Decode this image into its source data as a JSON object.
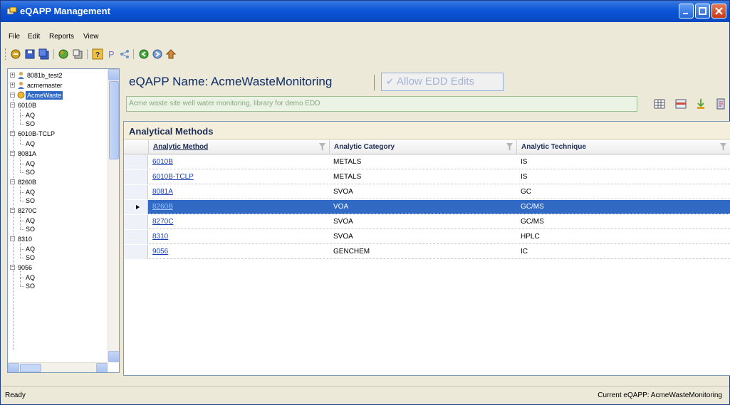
{
  "window": {
    "title": "eQAPP Management"
  },
  "menu": {
    "items": [
      {
        "label": "File",
        "accel": "F"
      },
      {
        "label": "Edit",
        "accel": "E"
      },
      {
        "label": "Reports",
        "accel": "R"
      },
      {
        "label": "View",
        "accel": "V"
      }
    ]
  },
  "tree": {
    "nodes": [
      {
        "label": "8081b_test2",
        "level": 0
      },
      {
        "label": "acmemaster",
        "level": 0
      },
      {
        "label": "AcmeWaste",
        "level": 0,
        "selected": true
      },
      {
        "label": "6010B",
        "level": 1
      },
      {
        "label": "AQ",
        "level": 2
      },
      {
        "label": "SO",
        "level": 2
      },
      {
        "label": "6010B-TCLP",
        "level": 1
      },
      {
        "label": "AQ",
        "level": 2
      },
      {
        "label": "8081A",
        "level": 1
      },
      {
        "label": "AQ",
        "level": 2
      },
      {
        "label": "SO",
        "level": 2
      },
      {
        "label": "8260B",
        "level": 1
      },
      {
        "label": "AQ",
        "level": 2
      },
      {
        "label": "SO",
        "level": 2
      },
      {
        "label": "8270C",
        "level": 1
      },
      {
        "label": "AQ",
        "level": 2
      },
      {
        "label": "SO",
        "level": 2
      },
      {
        "label": "8310",
        "level": 1
      },
      {
        "label": "AQ",
        "level": 2
      },
      {
        "label": "SO",
        "level": 2
      },
      {
        "label": "9056",
        "level": 1
      },
      {
        "label": "AQ",
        "level": 2
      },
      {
        "label": "SO",
        "level": 2
      }
    ]
  },
  "header": {
    "eqapp_label": "eQAPP Name: AcmeWasteMonitoring",
    "allow_edd": "Allow EDD Edits",
    "description": "Acme waste site well water monitoring, library for demo EDD"
  },
  "grid": {
    "title": "Analytical Methods",
    "columns": [
      "Analytic Method",
      "Analytic Category",
      "Analytic Technique"
    ],
    "rows": [
      {
        "method": "6010B",
        "category": "METALS",
        "technique": "IS"
      },
      {
        "method": "6010B-TCLP",
        "category": "METALS",
        "technique": "IS"
      },
      {
        "method": "8081A",
        "category": "SVOA",
        "technique": "GC"
      },
      {
        "method": "8260B",
        "category": "VOA",
        "technique": "GC/MS",
        "selected": true
      },
      {
        "method": "8270C",
        "category": "SVOA",
        "technique": "GC/MS"
      },
      {
        "method": "8310",
        "category": "SVOA",
        "technique": "HPLC"
      },
      {
        "method": "9056",
        "category": "GENCHEM",
        "technique": "IC"
      }
    ]
  },
  "status": {
    "left": "Ready",
    "right": "Current eQAPP: AcmeWasteMonitoring"
  },
  "colors": {
    "titlebar": "#0a55d8",
    "selection": "#316ac5",
    "link": "#1a3fb0"
  }
}
